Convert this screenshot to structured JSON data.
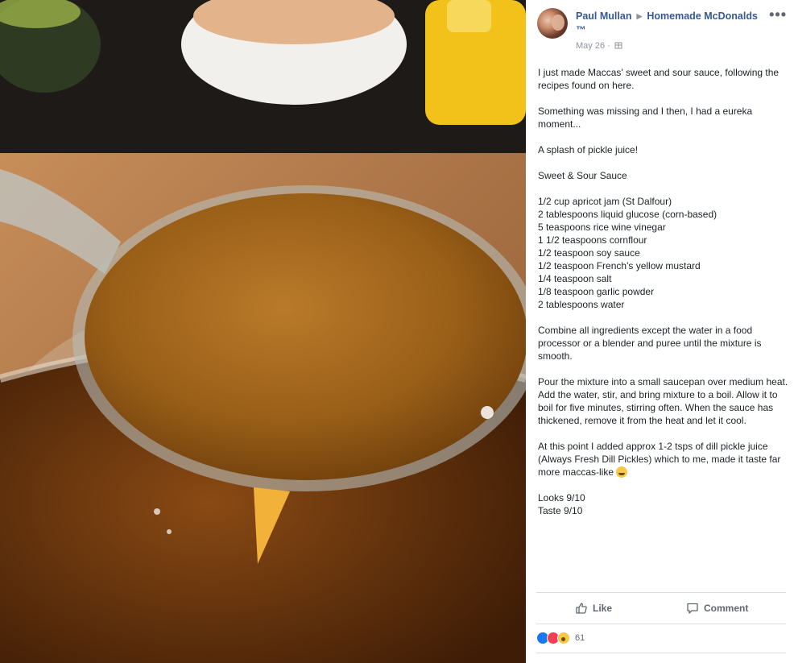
{
  "post": {
    "author": "Paul Mullan",
    "group": "Homemade McDonalds",
    "group_suffix": "™",
    "date": "May 26",
    "date_sep": "·",
    "paragraphs": [
      "I just made Maccas' sweet and sour sauce, following the recipes found on here.",
      "Something was missing and I then, I had a eureka moment...",
      "A splash of pickle juice!",
      "Sweet & Sour Sauce",
      "1/2 cup apricot jam (St Dalfour)\n2 tablespoons liquid glucose (corn-based)\n5 teaspoons rice wine vinegar\n1 1/2 teaspoons cornflour\n1/2 teaspoon soy sauce\n1/2 teaspoon French's yellow mustard\n1/4 teaspoon salt\n1/8 teaspoon garlic powder\n2 tablespoons water",
      "Combine all ingredients except the water in a food processor or a blender and puree until the mixture is smooth.",
      "Pour the mixture into a small saucepan over medium heat. Add the water, stir, and bring mixture to a boil. Allow it to boil for five minutes, stirring often. When the sauce has thickened, remove it from the heat and let it cool.",
      "At this point I added approx 1-2 tsps of dill pickle juice (Always Fresh Dill Pickles) which to me, made it taste far more maccas-like",
      "Looks 9/10\nTaste 9/10"
    ]
  },
  "actions": {
    "like": "Like",
    "comment": "Comment"
  },
  "reactions": {
    "count": "61"
  },
  "icons": {
    "more": "more-options-icon",
    "privacy": "globe-icon",
    "like": "thumbs-up-icon",
    "comment": "comment-bubble-icon",
    "emoji": "laughing-tears-emoji-icon"
  },
  "colors": {
    "link": "#365899",
    "text": "#1d2129",
    "muted": "#90949c",
    "divider": "#dadde1"
  }
}
